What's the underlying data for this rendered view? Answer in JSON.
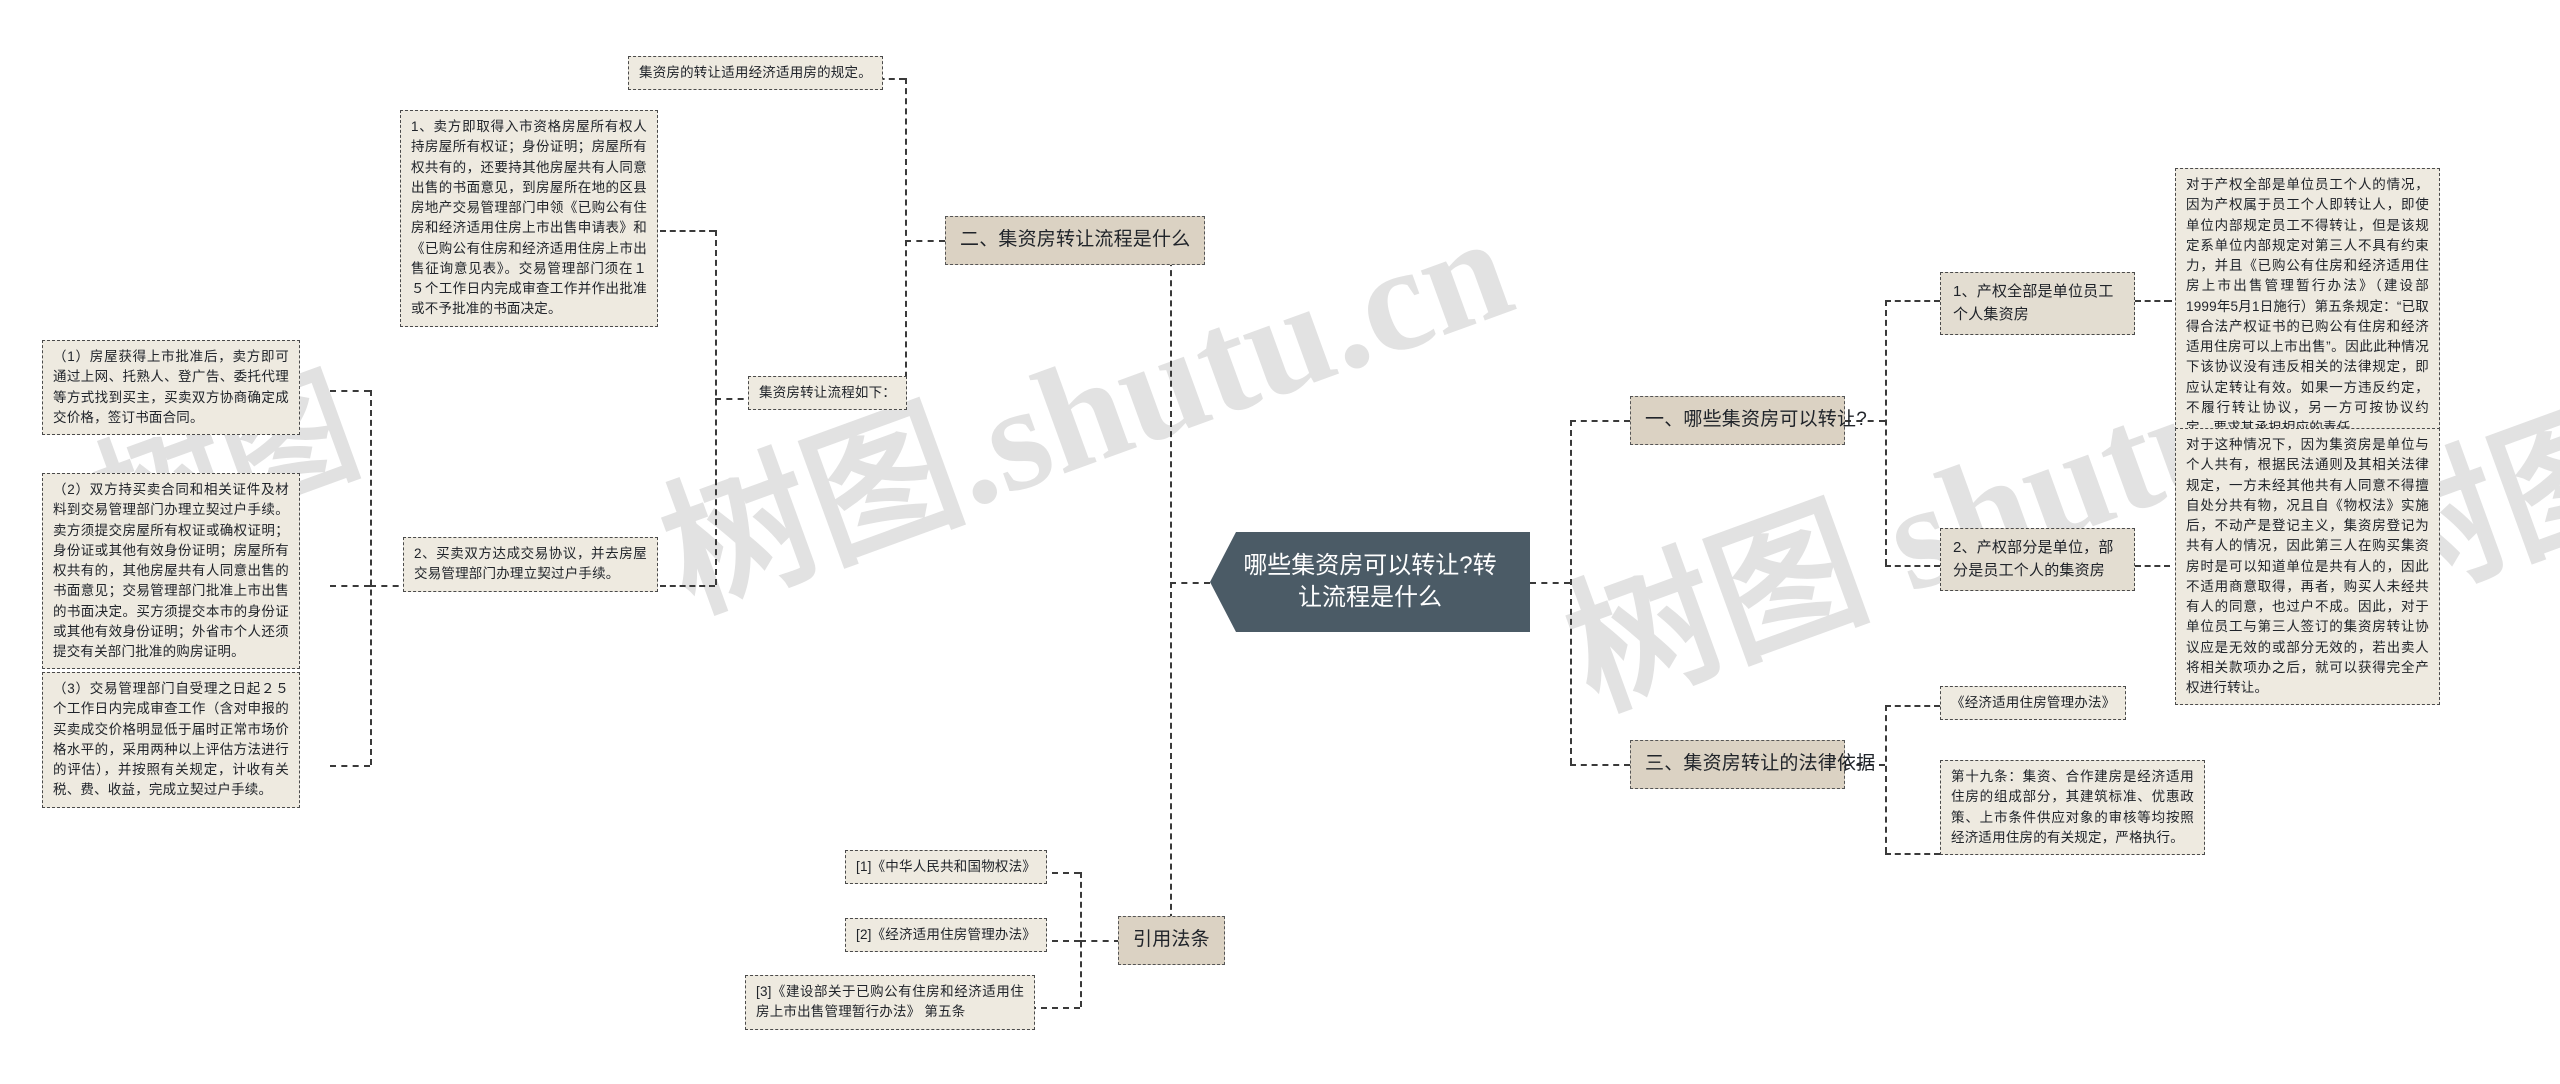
{
  "diagram": {
    "type": "mindmap",
    "root": {
      "label": "哪些集资房可以转让?转让流程是什么",
      "fill": "#4b5b66",
      "text_color": "#ffffff"
    },
    "colors": {
      "branch_fill": "#dbd2c3",
      "sub_fill": "#e3ddd1",
      "leaf_fill": "#eeeae0",
      "line": "#3a3a3a",
      "text": "#20242a"
    },
    "watermarks": [
      "树图.shutu.cn",
      "树图 shutu",
      "树图.shutu.c",
      "树图"
    ]
  },
  "branches": {
    "right_1": {
      "label": "一、哪些集资房可以转让?",
      "children": [
        {
          "label": "1、产权全部是单位员工个人集资房",
          "detail": "对于产权全部是单位员工个人的情况，因为产权属于员工个人即转让人，即使单位内部规定员工不得转让，但是该规定系单位内部规定对第三人不具有约束力，并且《已购公有住房和经济适用住房上市出售管理暂行办法》（建设部1999年5月1日施行）第五条规定：“已取得合法产权证书的已购公有住房和经济适用住房可以上市出售”。因此此种情况下该协议没有违反相关的法律规定，即应认定转让有效。如果一方违反约定，不履行转让协议，另一方可按协议约定，要求其承担相应的责任。"
        },
        {
          "label": "2、产权部分是单位，部分是员工个人的集资房",
          "detail": "对于这种情况下，因为集资房是单位与个人共有，根据民法通则及其相关法律规定，一方未经其他共有人同意不得擅自处分共有物，况且自《物权法》实施后，不动产是登记主义，集资房登记为共有人的情况，因此第三人在购买集资房时是可以知道单位是共有人的，因此不适用商意取得，再者，购买人未经共有人的同意，也过户不成。因此，对于单位员工与第三人签订的集资房转让协议应是无效的或部分无效的，若出卖人将相关款项办之后，就可以获得完全产权进行转让。"
        }
      ]
    },
    "right_3": {
      "label": "三、集资房转让的法律依据",
      "children": [
        {
          "label": "《经济适用住房管理办法》"
        },
        {
          "label": "第十九条：集资、合作建房是经济适用住房的组成部分，其建筑标准、优惠政策、上市条件供应对象的审核等均按照经济适用住房的有关规定，严格执行。"
        }
      ]
    },
    "left_2": {
      "label": "二、集资房转让流程是什么",
      "note_top": "集资房的转让适用经济适用房的规定。",
      "flow_label": "集资房转让流程如下：",
      "steps": [
        {
          "label": "1、卖方即取得入市资格房屋所有权人持房屋所有权证；身份证明；房屋所有权共有的，还要持其他房屋共有人同意出售的书面意见，到房屋所在地的区县房地产交易管理部门申领《已购公有住房和经济适用住房上市出售申请表》和《已购公有住房和经济适用住房上市出售征询意见表》。交易管理部门须在１５个工作日内完成审查工作并作出批准或不予批准的书面决定。"
        },
        {
          "label": "2、买卖双方达成交易协议，并去房屋交易管理部门办理立契过户手续。",
          "children": [
            "（1）房屋获得上市批准后，卖方即可通过上网、托熟人、登广告、委托代理等方式找到买主，买卖双方协商确定成交价格，签订书面合同。",
            "（2）双方持买卖合同和相关证件及材料到交易管理部门办理立契过户手续。卖方须提交房屋所有权证或确权证明；身份证或其他有效身份证明；房屋所有权共有的，其他房屋共有人同意出售的书面意见；交易管理部门批准上市出售的书面决定。买方须提交本市的身份证或其他有效身份证明；外省市个人还须提交有关部门批准的购房证明。",
            "（3）交易管理部门自受理之日起２５个工作日内完成审查工作（含对申报的买卖成交价格明显低于届时正常市场价格水平的，采用两种以上评估方法进行的评估），并按照有关规定，计收有关税、费、收益，完成立契过户手续。"
          ]
        }
      ]
    },
    "left_refs": {
      "label": "引用法条",
      "items": [
        "[1]《中华人民共和国物权法》",
        "[2]《经济适用住房管理办法》",
        "[3]《建设部关于已购公有住房和经济适用住房上市出售管理暂行办法》 第五条"
      ]
    }
  }
}
